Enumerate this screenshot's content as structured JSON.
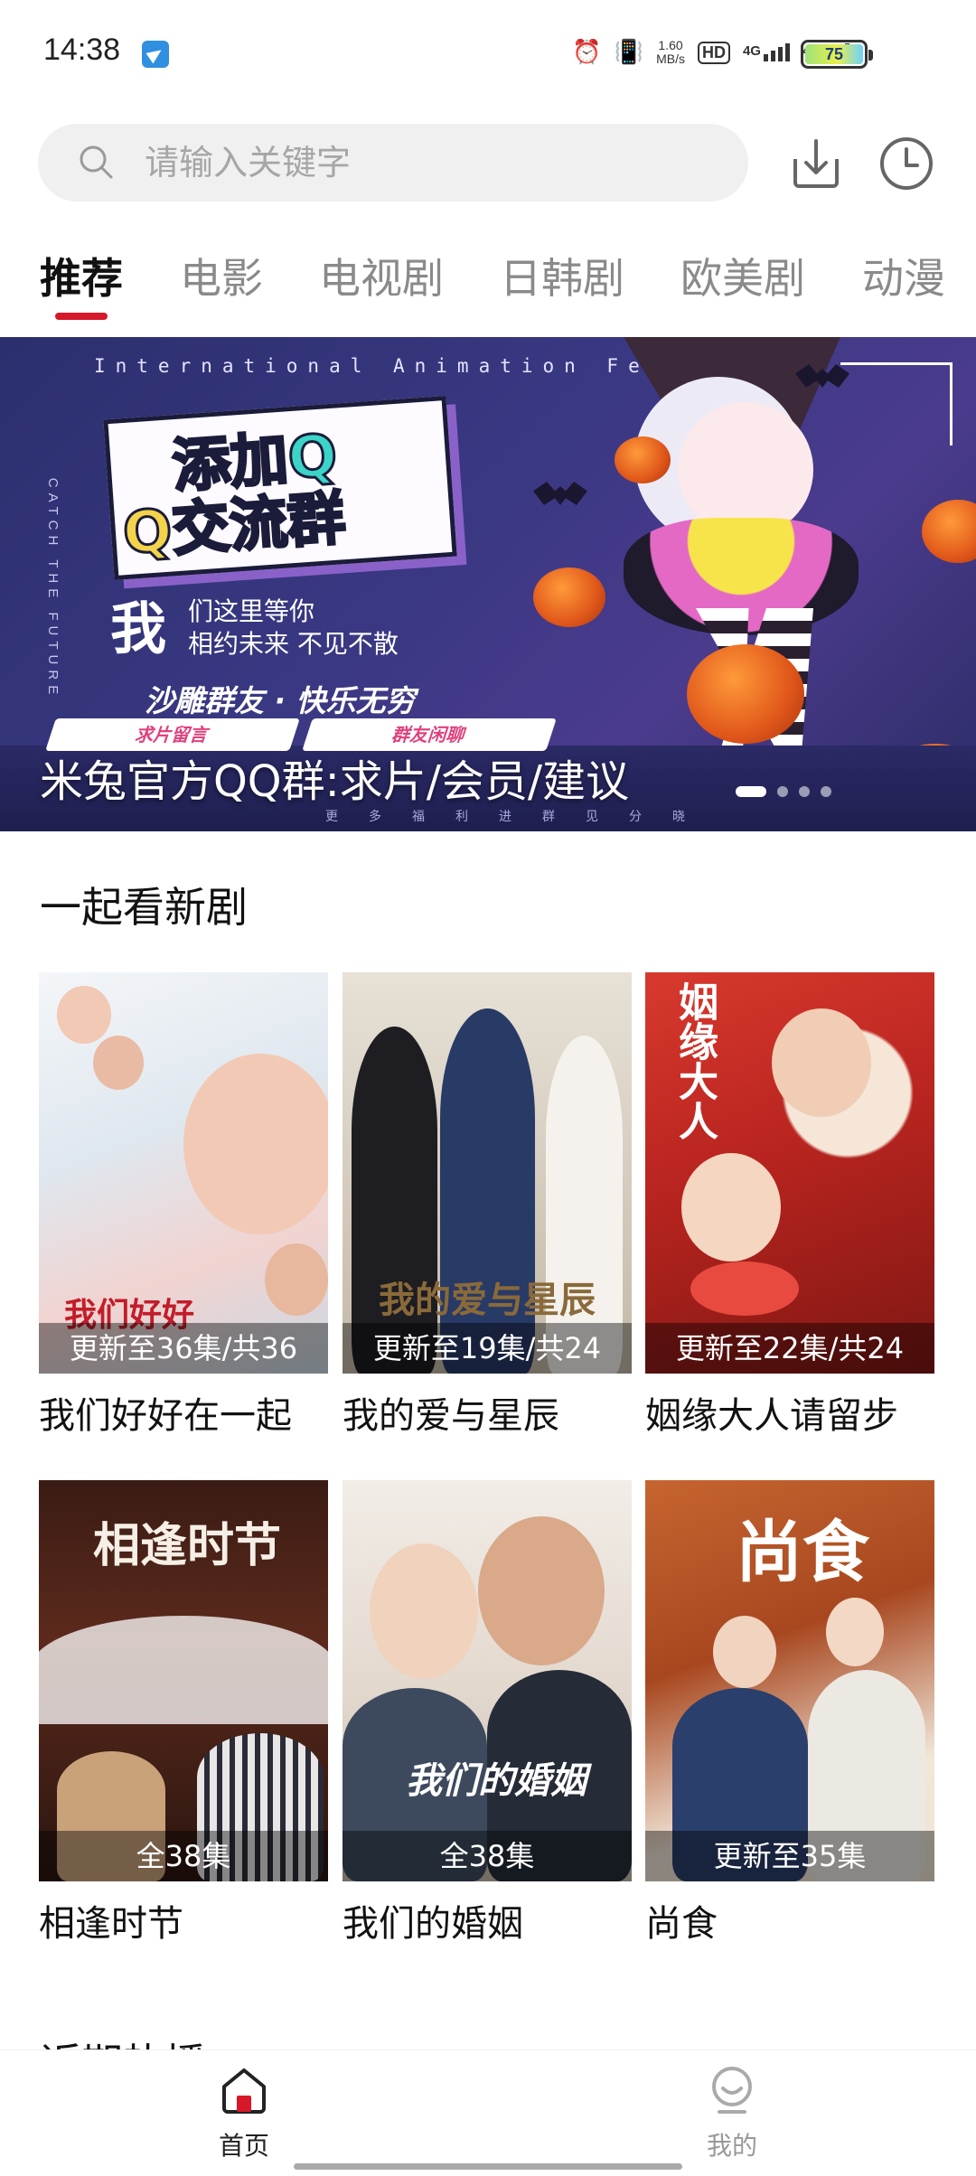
{
  "status_bar": {
    "time": "14:38",
    "net_speed_value": "1.60",
    "net_speed_unit": "MB/s",
    "hd_label": "HD",
    "sim1_label": "4G",
    "sim2_label": "4G",
    "battery_level": "75",
    "icons": [
      "alarm-icon",
      "vibrate-icon",
      "signal-icon",
      "battery-icon"
    ]
  },
  "search": {
    "placeholder": "请输入关键字",
    "value": ""
  },
  "tabs": [
    {
      "label": "推荐",
      "active": true
    },
    {
      "label": "电影",
      "active": false
    },
    {
      "label": "电视剧",
      "active": false
    },
    {
      "label": "日韩剧",
      "active": false
    },
    {
      "label": "欧美剧",
      "active": false
    },
    {
      "label": "动漫",
      "active": false
    }
  ],
  "banner": {
    "caption": "米兔官方QQ群:求片/会员/建议",
    "art": {
      "festival": "International Animation Festival",
      "catch": "CATCH THE FUTURE",
      "headline1": "添加Q",
      "headline2": "Q交流群",
      "me": "我",
      "line1": "们这里等你",
      "line2": "相约未来 不见不散",
      "slogan": "沙雕群友 · 快乐无穷",
      "pill1": "求片留言",
      "pill2": "群友闲聊",
      "bottom_text": "更多福利进群见分晓"
    },
    "slide_count": 5,
    "active_slide": 0
  },
  "section": {
    "title": "一起看新剧",
    "items": [
      {
        "title": "我们好好在一起",
        "badge": "更新至36集/共36",
        "poster_text": "我们好好"
      },
      {
        "title": "我的爱与星辰",
        "badge": "更新至19集/共24",
        "poster_text": "我的爱与星辰"
      },
      {
        "title": "姻缘大人请留步",
        "badge": "更新至22集/共24",
        "poster_text": "姻缘大人"
      },
      {
        "title": "相逢时节",
        "badge": "全38集",
        "poster_text": "相逢时节"
      },
      {
        "title": "我们的婚姻",
        "badge": "全38集",
        "poster_text": "我们的婚姻"
      },
      {
        "title": "尚食",
        "badge": "更新至35集",
        "poster_text": "尚食"
      }
    ]
  },
  "next_section": {
    "title": "近期热播"
  },
  "bottom_nav": [
    {
      "label": "首页",
      "icon": "home-icon",
      "active": true
    },
    {
      "label": "我的",
      "icon": "profile-icon",
      "active": false
    }
  ],
  "colors": {
    "accent": "#d6182a",
    "tab_inactive": "#8a8a8a",
    "search_bg": "#f0f0f0"
  }
}
